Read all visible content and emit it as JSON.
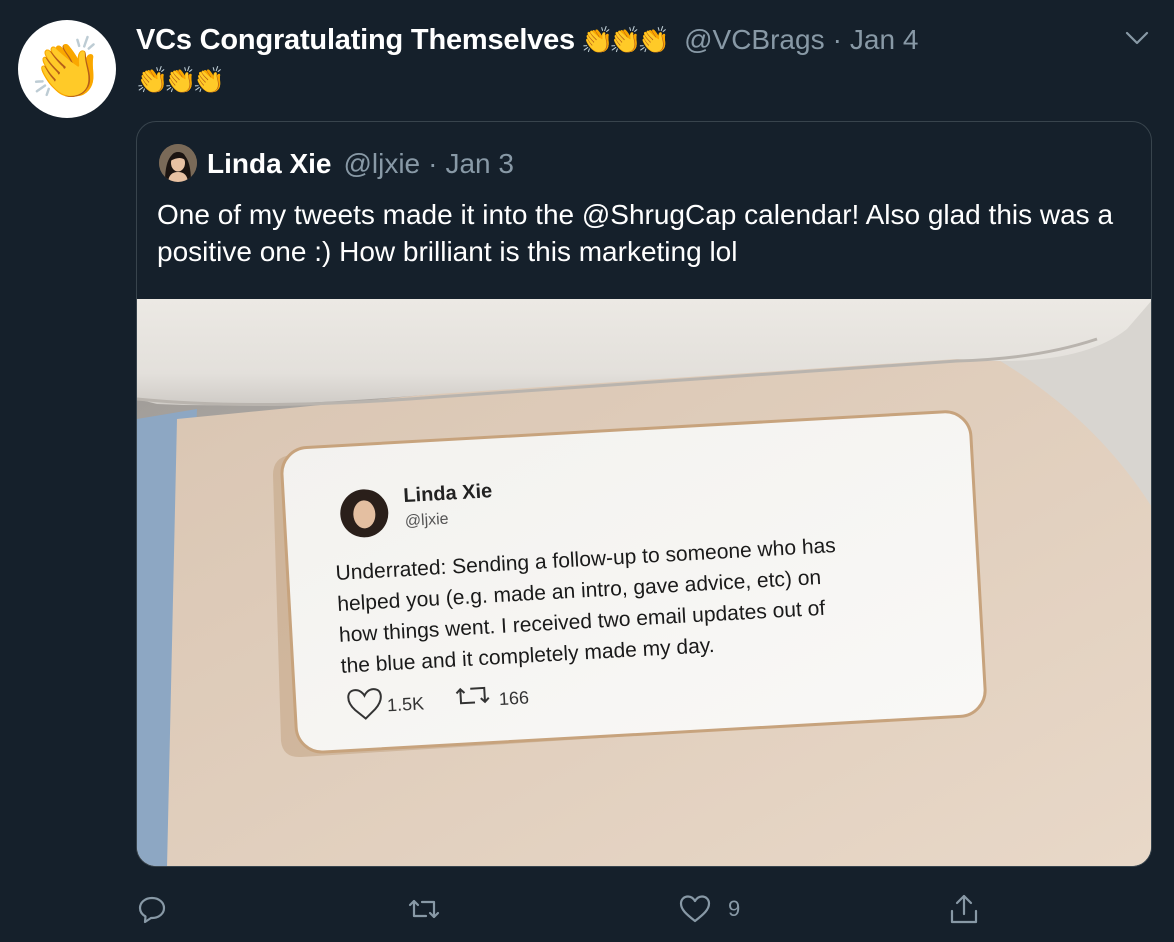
{
  "tweet": {
    "display_name": "VCs Congratulating Themselves",
    "name_emoji": "👏👏👏",
    "handle": "@VCBrags",
    "separator": "·",
    "date": "Jan 4",
    "avatar_emoji": "👏",
    "text": "👏👏👏",
    "menu_icon": "chevron-down-icon"
  },
  "quoted": {
    "display_name": "Linda Xie",
    "handle": "@ljxie",
    "separator": "·",
    "date": "Jan 3",
    "text": "One of my tweets made it into the @ShrugCap calendar! Also glad this was a positive one :) How brilliant is this marketing lol",
    "photo": {
      "card_name": "Linda Xie",
      "card_handle": "@ljxie",
      "card_text_lines": [
        "Underrated: Sending a follow-up to someone who has",
        "helped you (e.g. made an intro, gave advice, etc) on",
        "how things went. I received two email updates out of",
        "the blue and it completely made my day."
      ],
      "card_likes": "1.5K",
      "card_retweets": "166"
    }
  },
  "actions": {
    "reply_icon": "reply-icon",
    "retweet_icon": "retweet-icon",
    "like_icon": "heart-icon",
    "like_count": "9",
    "share_icon": "share-icon"
  },
  "colors": {
    "background": "#15202b",
    "secondary_text": "#8899a6",
    "border": "#38444d"
  }
}
